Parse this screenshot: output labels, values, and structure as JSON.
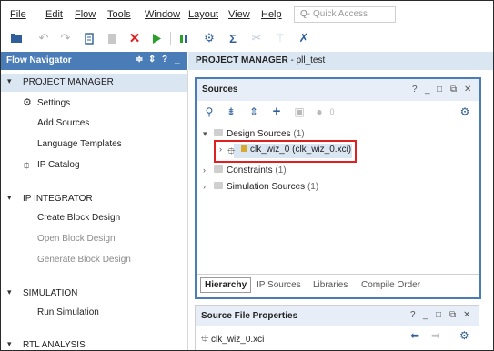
{
  "menu": [
    {
      "label": "File"
    },
    {
      "label": "Edit"
    },
    {
      "label": "Flow"
    },
    {
      "label": "Tools"
    },
    {
      "label": "Window"
    },
    {
      "label": "Layout"
    },
    {
      "label": "View"
    },
    {
      "label": "Help"
    }
  ],
  "quick_access": {
    "placeholder": "Quick Access",
    "icon": "search-icon"
  },
  "toolbar": {
    "icons": [
      "open-project-icon",
      "undo-icon",
      "redo-icon",
      "copy-icon",
      "paste-icon",
      "delete-icon",
      "run-icon",
      "step-icon",
      "settings-icon",
      "sigma-icon",
      "cut-icon",
      "magic-wand-icon",
      "cancel-icon"
    ],
    "colors": {
      "delete": "#e02020",
      "run": "#2aa02a",
      "accent": "#2e5f9a"
    }
  },
  "flow_navigator": {
    "title": "Flow Navigator",
    "controls": [
      "≑",
      "⇕",
      "?",
      "_"
    ],
    "sections": [
      {
        "label": "PROJECT MANAGER",
        "items": [
          {
            "label": "Settings",
            "icon": "gear-icon",
            "enabled": true
          },
          {
            "label": "Add Sources",
            "enabled": true
          },
          {
            "label": "Language Templates",
            "enabled": true
          },
          {
            "label": "IP Catalog",
            "icon": "ip-plug-icon",
            "enabled": true
          }
        ]
      },
      {
        "label": "IP INTEGRATOR",
        "items": [
          {
            "label": "Create Block Design",
            "enabled": true
          },
          {
            "label": "Open Block Design",
            "enabled": false
          },
          {
            "label": "Generate Block Design",
            "enabled": false
          }
        ]
      },
      {
        "label": "SIMULATION",
        "items": [
          {
            "label": "Run Simulation",
            "enabled": true
          }
        ]
      },
      {
        "label": "RTL ANALYSIS",
        "items": []
      }
    ]
  },
  "project_header": {
    "prefix": "PROJECT MANAGER",
    "separator": " - ",
    "project": "pll_test"
  },
  "sources": {
    "title": "Sources",
    "controls": [
      "?",
      "_",
      "□",
      "⧉",
      "✕"
    ],
    "toolbar": [
      "search-icon",
      "collapse-all-icon",
      "expand-all-icon",
      "add-icon",
      "info-icon",
      "status-dot-icon",
      "gear-icon"
    ],
    "toolbar_count": "0",
    "tree": [
      {
        "label": "Design Sources",
        "count": "(1)",
        "expanded": true,
        "children": [
          {
            "label": "clk_wiz_0 (clk_wiz_0.xci)",
            "highlighted": true
          }
        ]
      },
      {
        "label": "Constraints",
        "count": "(1)",
        "expanded": false
      },
      {
        "label": "Simulation Sources",
        "count": "(1)",
        "expanded": false
      }
    ],
    "tabs": [
      {
        "label": "Hierarchy",
        "selected": true
      },
      {
        "label": "IP Sources",
        "selected": false
      },
      {
        "label": "Libraries",
        "selected": false
      },
      {
        "label": "Compile Order",
        "selected": false
      }
    ],
    "highlight_color": "#e02020"
  },
  "source_file_properties": {
    "title": "Source File Properties",
    "controls": [
      "?",
      "_",
      "□",
      "⧉",
      "✕"
    ],
    "file": "clk_wiz_0.xci"
  }
}
